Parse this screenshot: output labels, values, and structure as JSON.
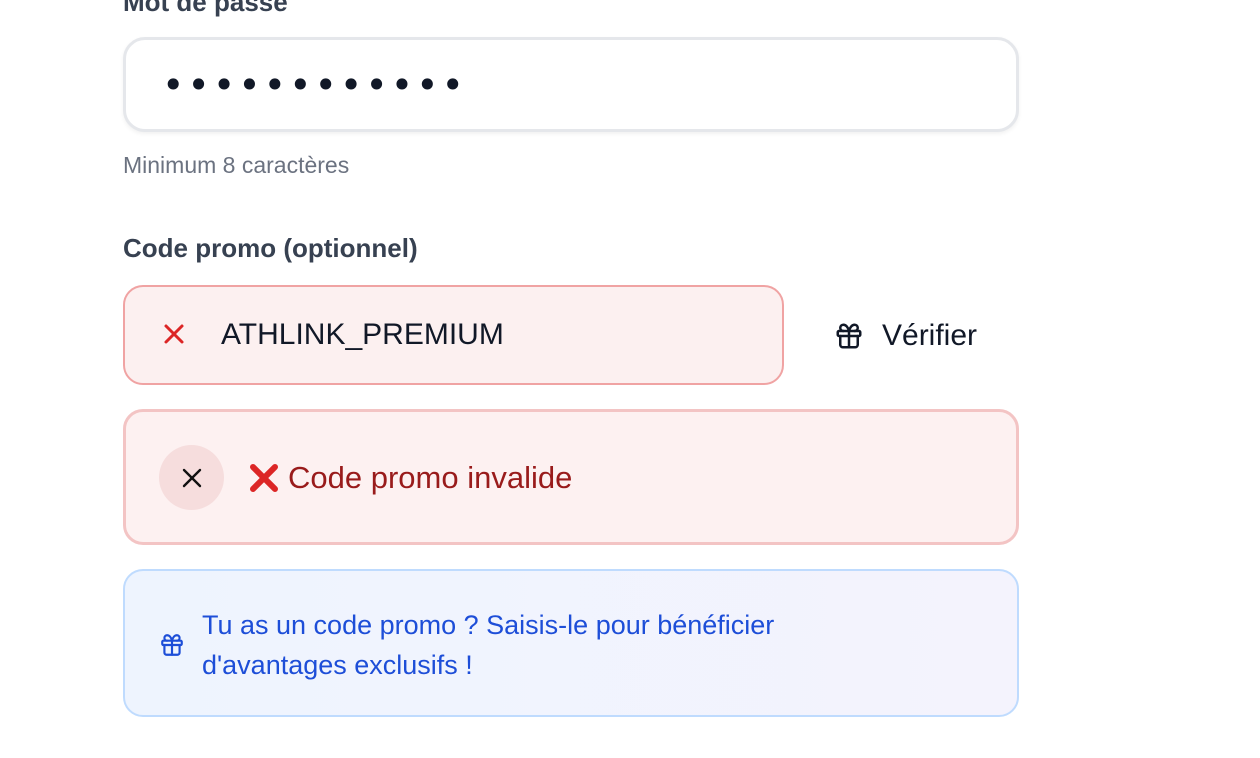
{
  "password": {
    "label": "Mot de passe",
    "value": "••••••••••••",
    "hint": "Minimum 8 caractères"
  },
  "promo": {
    "label": "Code promo (optionnel)",
    "value": "ATHLINK_PREMIUM",
    "status_icon": "x-icon",
    "verify_label": "Vérifier",
    "verify_icon": "gift-icon"
  },
  "error": {
    "message": "Code promo invalide",
    "icon": "cross-mark-icon",
    "close_icon": "close-icon"
  },
  "info": {
    "message": "Tu as un code promo ? Saisis-le pour bénéficier d'avantages exclusifs !",
    "icon": "gift-icon"
  },
  "colors": {
    "error_red": "#dc2626",
    "error_text": "#991b1b",
    "info_blue": "#1d4ed8"
  }
}
